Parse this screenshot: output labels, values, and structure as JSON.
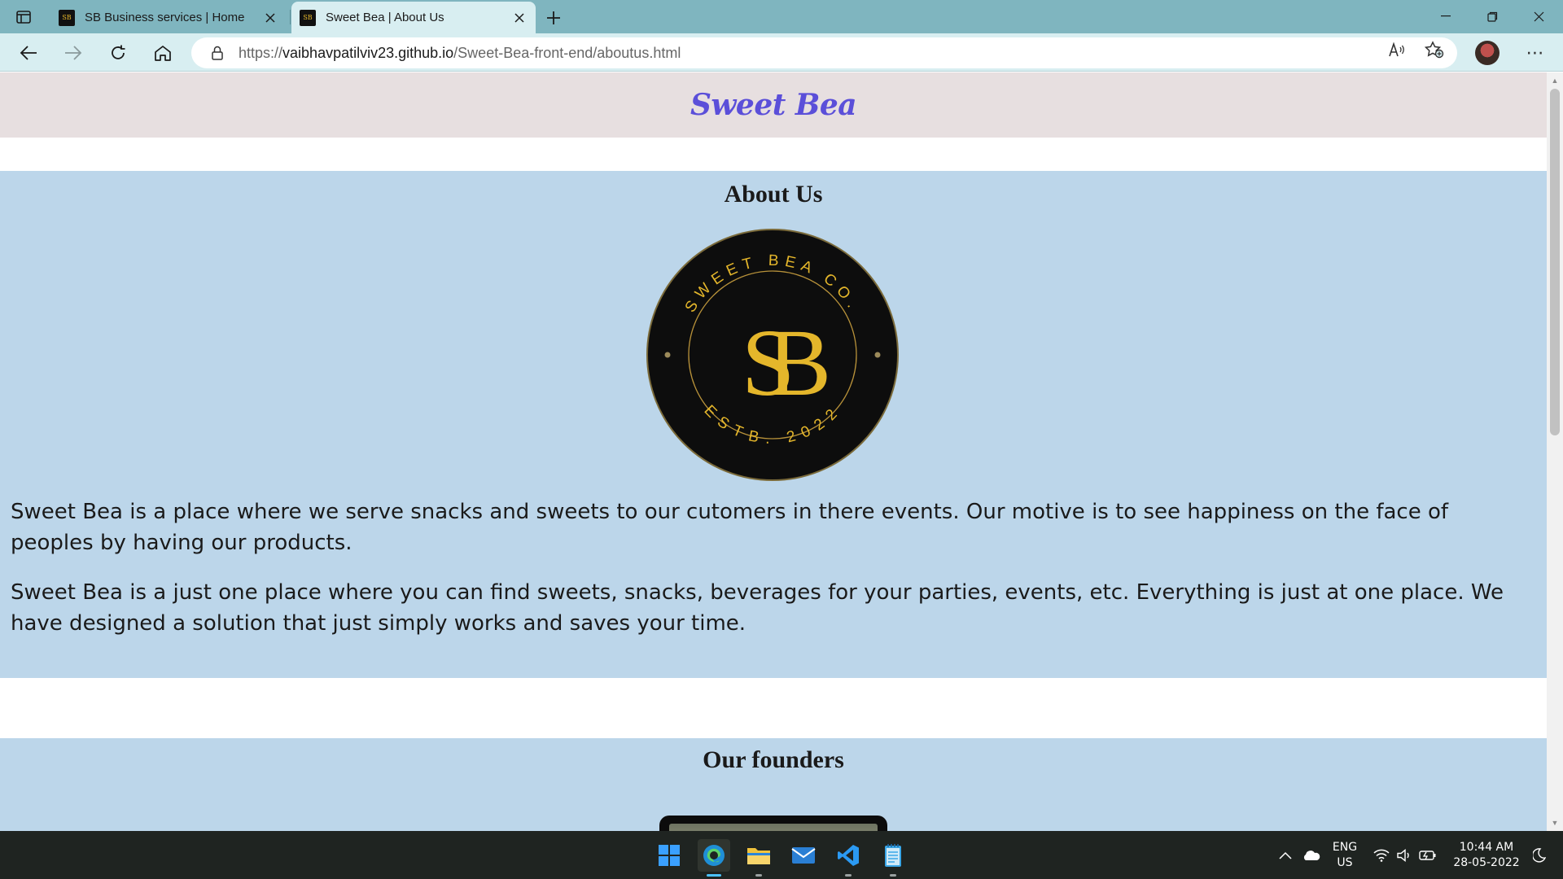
{
  "browser": {
    "tabs": [
      {
        "title": "SB Business services | Home",
        "favicon_text": "SB",
        "active": false
      },
      {
        "title": "Sweet Bea | About Us",
        "favicon_text": "SB",
        "active": true
      }
    ],
    "address": {
      "scheme": "https://",
      "host": "vaibhavpatilviv23.github.io",
      "path": "/Sweet-Bea-front-end/aboutus.html"
    },
    "icons": {
      "back": "back-arrow-icon",
      "forward": "forward-arrow-icon",
      "refresh": "refresh-icon",
      "home": "home-icon",
      "read_aloud": "read-aloud-icon",
      "favorites": "add-favorite-icon",
      "more": "more-icon"
    },
    "more_label": "⋯"
  },
  "page": {
    "brand": "Sweet Bea",
    "about": {
      "title": "About Us",
      "logo": {
        "top_text": "SWEET BEA CO.",
        "monogram": "SB",
        "bottom_text": "ESTB. 2022"
      },
      "paragraphs": [
        "Sweet Bea is a place where we serve snacks and sweets to our cutomers in there events. Our motive is to see happiness on the face of peoples by having our products.",
        "Sweet Bea is a just one place where you can find sweets, snacks, beverages for your parties, events, etc. Everything is just at one place. We have designed a solution that just simply works and saves your time."
      ]
    },
    "founders": {
      "title": "Our founders"
    }
  },
  "colors": {
    "header_bg": "#e7dfe0",
    "brand": "#5b4fd9",
    "section_bg": "#bcd6ea",
    "logo_gold": "#e4b62b",
    "logo_bg": "#0d0d0d",
    "tabbar": "#7fb5bf",
    "toolbar": "#d8eef1",
    "taskbar": "#1f2421"
  },
  "taskbar": {
    "apps": [
      "windows-start-icon",
      "edge-icon",
      "file-explorer-icon",
      "mail-icon",
      "vscode-icon",
      "notepad-icon"
    ],
    "language": "ENG",
    "region": "US",
    "time": "10:44 AM",
    "date": "28-05-2022"
  }
}
